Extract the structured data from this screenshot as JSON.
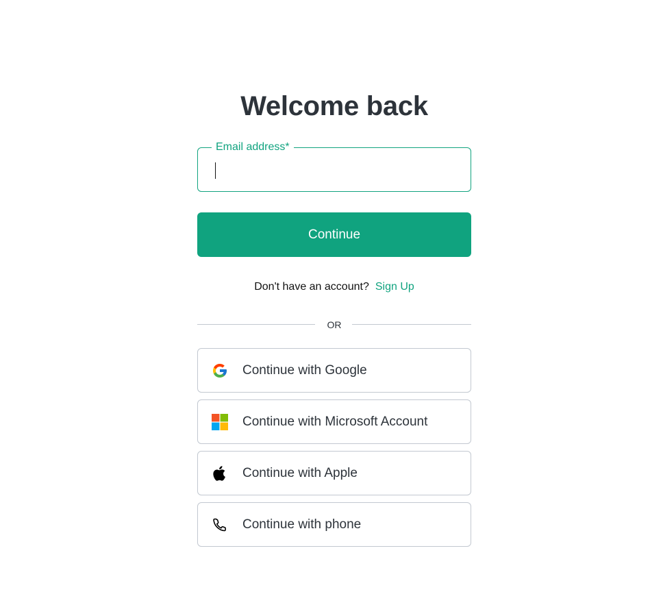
{
  "header": {
    "title": "Welcome back"
  },
  "login_form": {
    "email_label": "Email address*",
    "email_value": "",
    "continue_label": "Continue"
  },
  "signup": {
    "prompt": "Don't have an account?",
    "link_label": "Sign Up"
  },
  "divider": {
    "label": "OR"
  },
  "social_logins": [
    {
      "label": "Continue with Google",
      "icon": "google-icon"
    },
    {
      "label": "Continue with Microsoft Account",
      "icon": "microsoft-icon"
    },
    {
      "label": "Continue with Apple",
      "icon": "apple-icon"
    },
    {
      "label": "Continue with phone",
      "icon": "phone-icon"
    }
  ],
  "colors": {
    "accent": "#10a37f",
    "text": "#2d333a",
    "border": "#c2c8d0"
  }
}
